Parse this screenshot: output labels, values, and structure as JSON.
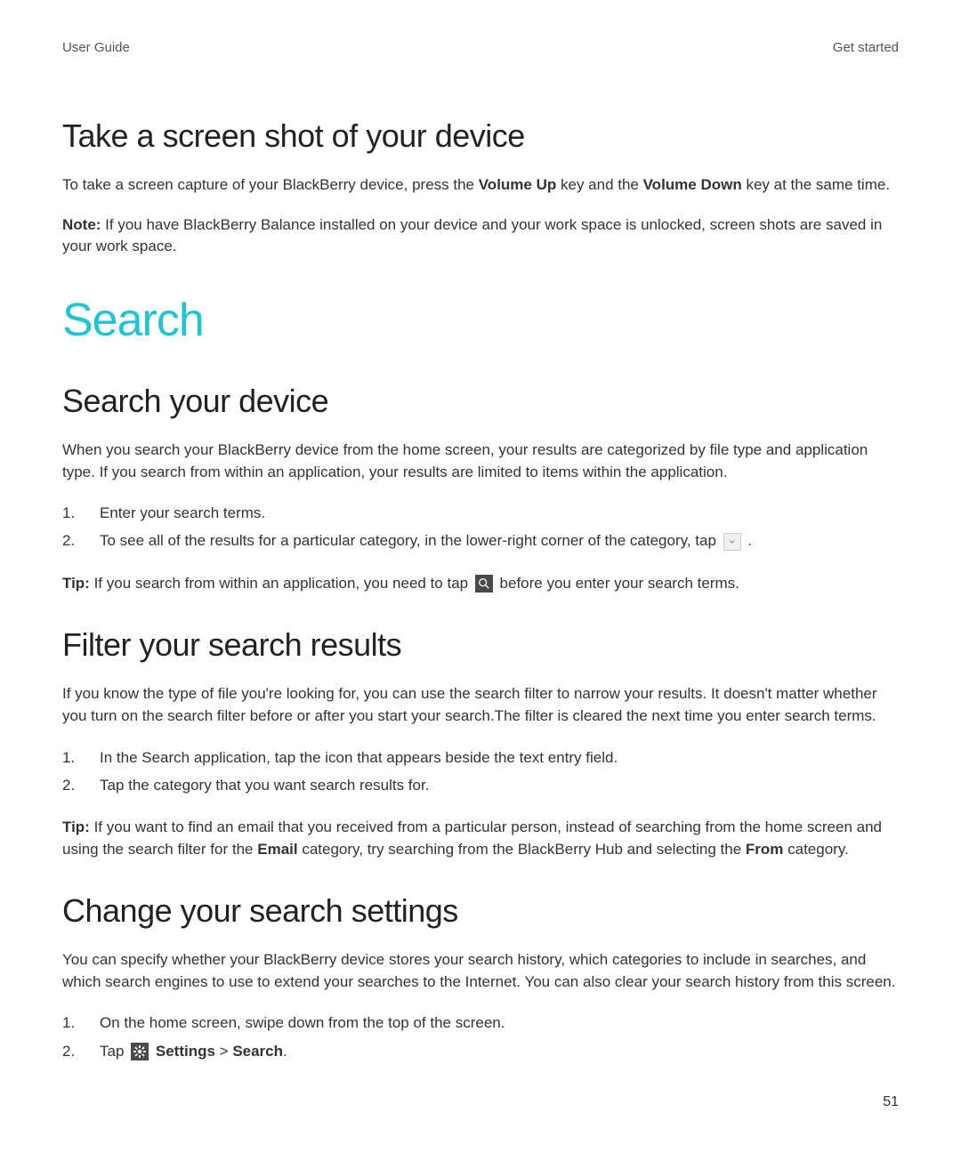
{
  "header": {
    "left": "User Guide",
    "right": "Get started"
  },
  "page_number": "51",
  "section_screenshot": {
    "heading": "Take a screen shot of your device",
    "p1_a": "To take a screen capture of your BlackBerry device, press the ",
    "p1_bold1": "Volume Up",
    "p1_b": " key and the ",
    "p1_bold2": "Volume Down",
    "p1_c": " key at the same time.",
    "p2_bold": "Note: ",
    "p2_rest": "If you have BlackBerry Balance installed on your device and your work space is unlocked, screen shots are saved in your work space."
  },
  "major_heading": "Search",
  "section_search_device": {
    "heading": "Search your device",
    "intro": "When you search your BlackBerry device from the home screen, your results are categorized by file type and application type. If you search from within an application, your results are limited to items within the application.",
    "step1": "Enter your search terms.",
    "step2_a": "To see all of the results for a particular category, in the lower-right corner of the category, tap ",
    "step2_b": " .",
    "tip_bold": "Tip: ",
    "tip_a": "If you search from within an application, you need to tap ",
    "tip_b": " before you enter your search terms."
  },
  "section_filter": {
    "heading": "Filter your search results",
    "intro": "If you know the type of file you're looking for, you can use the search filter to narrow your results. It doesn't matter whether you turn on the search filter before or after you start your search.The filter is cleared the next time you enter search terms.",
    "step1": "In the Search application, tap the icon that appears beside the text entry field.",
    "step2": "Tap the category that you want search results for.",
    "tip_bold": "Tip: ",
    "tip_a": "If you want to find an email that you received from a particular person, instead of searching from the home screen and using the search filter for the ",
    "tip_bold_email": "Email",
    "tip_b": " category, try searching from the BlackBerry Hub and selecting the ",
    "tip_bold_from": "From",
    "tip_c": " category."
  },
  "section_change_settings": {
    "heading": "Change your search settings",
    "intro": "You can specify whether your BlackBerry device stores your search history, which categories to include in searches, and which search engines to use to extend your searches to the Internet. You can also clear your search history from this screen.",
    "step1": "On the home screen, swipe down from the top of the screen.",
    "step2_a": "Tap ",
    "step2_b": " ",
    "step2_bold_settings": "Settings",
    "step2_c": " > ",
    "step2_bold_search": "Search",
    "step2_d": "."
  }
}
